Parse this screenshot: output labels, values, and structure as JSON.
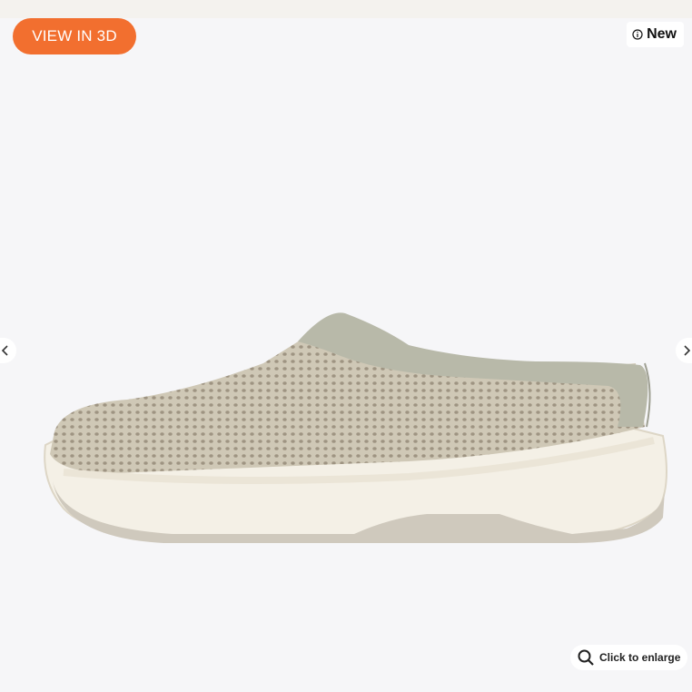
{
  "view3d_label": "VIEW IN 3D",
  "badge": {
    "label": "New",
    "icon": "info-icon"
  },
  "nav": {
    "prev_icon": "chevron-left-icon",
    "next_icon": "chevron-right-icon"
  },
  "enlarge": {
    "label": "Click to enlarge",
    "icon": "magnifier-icon"
  },
  "colors": {
    "accent": "#f26f2f",
    "shoe_upper": "#c9c1ae",
    "shoe_collar": "#b9b9a8",
    "sole": "#f3efe6"
  }
}
